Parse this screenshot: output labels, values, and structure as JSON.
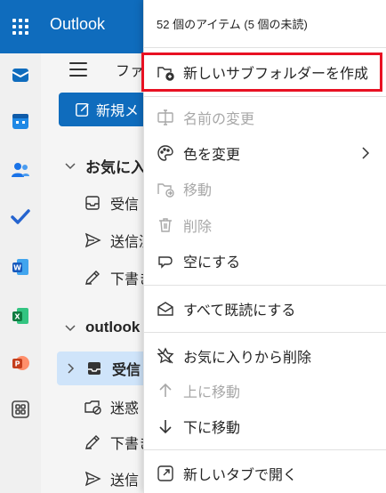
{
  "app": {
    "title": "Outlook"
  },
  "folder_pane": {
    "tab_label": "ファ",
    "new_mail_label": "新規メ",
    "favorites": {
      "label": "お気に入",
      "items": [
        "受信",
        "送信済",
        "下書き"
      ]
    },
    "account": {
      "label": "outlook",
      "items": [
        "受信",
        "迷惑",
        "下書き",
        "送信"
      ]
    }
  },
  "context_menu": {
    "header": "52 個のアイテム (5 個の未読)",
    "items": {
      "new_subfolder": "新しいサブフォルダーを作成",
      "rename": "名前の変更",
      "change_color": "色を変更",
      "move": "移動",
      "delete": "削除",
      "empty": "空にする",
      "mark_all_read": "すべて既読にする",
      "remove_favorite": "お気に入りから削除",
      "move_up": "上に移動",
      "move_down": "下に移動",
      "open_new_tab": "新しいタブで開く"
    }
  },
  "colors": {
    "brand": "#0f6cbd",
    "highlight": "#e81123",
    "selected": "#cfe4fa"
  }
}
